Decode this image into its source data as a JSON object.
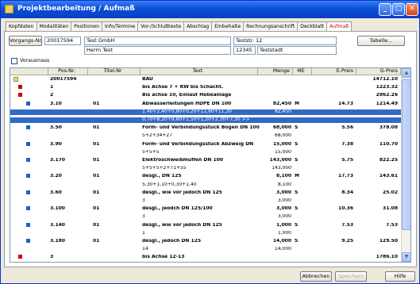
{
  "window": {
    "title": "Projektbearbeitung / Aufmaß"
  },
  "tabs": [
    "Kopfdaten",
    "Modalitäten",
    "Positionen",
    "Info/Termine",
    "Vor-/Schlußtexte",
    "Abschlag",
    "Einbehalte",
    "Rechnungsanschrift",
    "Deckblatt",
    "Aufmaß"
  ],
  "active_tab": 9,
  "header": {
    "vorgang_button": "Vorgangs-Nr.",
    "vorgang_nr": "20017594",
    "name1": "Test GmbH",
    "name2": "Herrn Test",
    "street": "Teststr. 12",
    "zip": "12345",
    "city": "Teststadt",
    "tabelle_button": "Tabelle...",
    "vorausmass_label": "Vorausmass"
  },
  "grid": {
    "columns": [
      "",
      "Pos-Nr.",
      "Titel-Nr",
      "Text",
      "Menge",
      "ME",
      "E-Preis",
      "G-Preis"
    ],
    "rows": [
      {
        "pos": "20017594",
        "titel": "",
        "text": "BAU",
        "menge": "",
        "me": "",
        "epreis": "",
        "gpreis": "14712.10",
        "bold": true,
        "node": "yellow",
        "level": 0
      },
      {
        "pos": "1",
        "titel": "",
        "text": "bis Achse 7 + RW bis Schacht.",
        "menge": "",
        "me": "",
        "epreis": "",
        "gpreis": "1223.32",
        "bold": true,
        "node": "red",
        "level": 1
      },
      {
        "pos": "2",
        "titel": "",
        "text": "Bis achse 10, Einlauf Hebeanlage",
        "menge": "",
        "me": "",
        "epreis": "",
        "gpreis": "2862.26",
        "bold": true,
        "node": "red",
        "level": 1
      },
      {
        "pos": "3.10",
        "titel": "01",
        "text": "Abwasserleitungen HDPE DN 100",
        "menge": "82,450",
        "me": "M",
        "epreis": "14.73",
        "gpreis": "1214.49",
        "bold": true,
        "node": "blue",
        "level": 2
      },
      {
        "pos": "",
        "titel": "",
        "text": "1,40+2,40+0,80+0,20+11,60+11,30",
        "menge": "82,450",
        "me": "",
        "epreis": "",
        "gpreis": "",
        "bold": false,
        "node": "",
        "level": 3,
        "selected": true
      },
      {
        "pos": "",
        "titel": "",
        "text": "0,70+8,20+9,60+1,50+1,20+2,30+7,30 >>",
        "menge": "",
        "me": "",
        "epreis": "",
        "gpreis": "",
        "bold": false,
        "node": "",
        "level": 3,
        "selected": true
      },
      {
        "pos": "3.50",
        "titel": "01",
        "text": "Form- und Verbindungsstück Bogen DN 100",
        "menge": "68,000",
        "me": "S",
        "epreis": "5.56",
        "gpreis": "378.08",
        "bold": true,
        "node": "blue",
        "level": 2
      },
      {
        "pos": "",
        "titel": "",
        "text": "5+2+34+27",
        "menge": "68,000",
        "me": "",
        "epreis": "",
        "gpreis": "",
        "bold": false,
        "node": "",
        "level": 3
      },
      {
        "pos": "3.90",
        "titel": "01",
        "text": "Form- und Verbindungsstück Abzweig DN",
        "menge": "15,000",
        "me": "S",
        "epreis": "7.38",
        "gpreis": "110.70",
        "bold": true,
        "node": "blue",
        "level": 2
      },
      {
        "pos": "",
        "titel": "",
        "text": "5+5+5",
        "menge": "15,000",
        "me": "",
        "epreis": "",
        "gpreis": "",
        "bold": false,
        "node": "",
        "level": 3
      },
      {
        "pos": "3.170",
        "titel": "01",
        "text": "Elektroschweißmuffen DN 100",
        "menge": "143,000",
        "me": "S",
        "epreis": "5.75",
        "gpreis": "822.25",
        "bold": true,
        "node": "blue",
        "level": 2
      },
      {
        "pos": "",
        "titel": "",
        "text": "5+5+5+2+71+55",
        "menge": "143,000",
        "me": "",
        "epreis": "",
        "gpreis": "",
        "bold": false,
        "node": "",
        "level": 3
      },
      {
        "pos": "3.20",
        "titel": "01",
        "text": "desgl., DN 125",
        "menge": "8,100",
        "me": "M",
        "epreis": "17.73",
        "gpreis": "143.61",
        "bold": true,
        "node": "blue",
        "level": 2
      },
      {
        "pos": "",
        "titel": "",
        "text": "5,30+1,10+0,30+1,40",
        "menge": "8,100",
        "me": "",
        "epreis": "",
        "gpreis": "",
        "bold": false,
        "node": "",
        "level": 3
      },
      {
        "pos": "3.60",
        "titel": "01",
        "text": "desgl., wie vor jedoch DN 125",
        "menge": "3,000",
        "me": "S",
        "epreis": "8.34",
        "gpreis": "25.02",
        "bold": true,
        "node": "blue",
        "level": 2
      },
      {
        "pos": "",
        "titel": "",
        "text": "3",
        "menge": "3,000",
        "me": "",
        "epreis": "",
        "gpreis": "",
        "bold": false,
        "node": "",
        "level": 3
      },
      {
        "pos": "3.100",
        "titel": "01",
        "text": "desgl., jeodch DN 125/100",
        "menge": "3,000",
        "me": "S",
        "epreis": "10.36",
        "gpreis": "31.08",
        "bold": true,
        "node": "blue",
        "level": 2
      },
      {
        "pos": "",
        "titel": "",
        "text": "3",
        "menge": "3,000",
        "me": "",
        "epreis": "",
        "gpreis": "",
        "bold": false,
        "node": "",
        "level": 3
      },
      {
        "pos": "3.140",
        "titel": "01",
        "text": "desgl., wie vor jedoch DN 125",
        "menge": "1,000",
        "me": "S",
        "epreis": "7.53",
        "gpreis": "7.53",
        "bold": true,
        "node": "blue",
        "level": 2
      },
      {
        "pos": "",
        "titel": "",
        "text": "1",
        "menge": "1,000",
        "me": "",
        "epreis": "",
        "gpreis": "",
        "bold": false,
        "node": "",
        "level": 3
      },
      {
        "pos": "3.180",
        "titel": "01",
        "text": "desgl., jedoch DN 125",
        "menge": "14,000",
        "me": "S",
        "epreis": "9.25",
        "gpreis": "129.50",
        "bold": true,
        "node": "blue",
        "level": 2
      },
      {
        "pos": "",
        "titel": "",
        "text": "14",
        "menge": "14,000",
        "me": "",
        "epreis": "",
        "gpreis": "",
        "bold": false,
        "node": "",
        "level": 3
      },
      {
        "pos": "3",
        "titel": "",
        "text": "bis Achse 12-13",
        "menge": "",
        "me": "",
        "epreis": "",
        "gpreis": "1786.10",
        "bold": true,
        "node": "red",
        "level": 1
      }
    ]
  },
  "footer": {
    "abbrechen": "Abbrechen",
    "speichern": "Speichern",
    "hilfe": "Hilfe"
  },
  "colors": {
    "title_bar": "#0a4fd8",
    "selection": "#316ac5",
    "node_red": "#cc0000",
    "node_blue": "#1d5fd1",
    "node_yellow": "#f2e23a"
  }
}
